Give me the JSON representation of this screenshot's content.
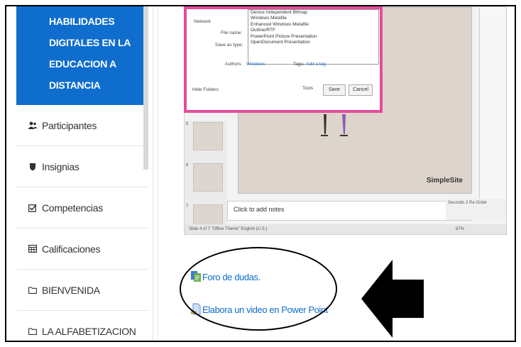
{
  "sidebar": {
    "course_title": [
      "HABILIDADES",
      "DIGITALES EN LA",
      "EDUCACION A",
      "DISTANCIA"
    ],
    "items": [
      {
        "label": "Participantes",
        "icon": "users-icon"
      },
      {
        "label": "Insignias",
        "icon": "shield-icon"
      },
      {
        "label": "Competencias",
        "icon": "checkbox-icon"
      },
      {
        "label": "Calificaciones",
        "icon": "table-icon"
      },
      {
        "label": "BIENVENIDA",
        "icon": "folder-icon"
      },
      {
        "label": "LA ALFABETIZACION",
        "icon": "folder-icon"
      }
    ]
  },
  "ppt": {
    "slide_logo": "SimpleSite",
    "notes_placeholder": "Click to add notes",
    "status_left": "Slide 4 of 7  \"Office Theme\"   English (U.S.)",
    "status_right": "67%",
    "thumb_numbers": [
      "5",
      "6",
      "7"
    ],
    "right_pane_label": "Seconds",
    "right_pane_value": "2",
    "right_pane_reorder": "Re-Order"
  },
  "dialog": {
    "type_options": [
      "Device Independent Bitmap",
      "Windows Metafile",
      "Enhanced Windows Metafile",
      "Outline/RTF",
      "PowerPoint Picture Presentation",
      "OpenDocument Presentation"
    ],
    "network_label": "Network",
    "file_name_label": "File name:",
    "save_as_type_label": "Save as type:",
    "authors_label": "Authors:",
    "authors_value": "Windows",
    "tags_label": "Tags:",
    "tags_value": "Add a tag",
    "hide_folders": "Hide Folders",
    "tools_label": "Tools",
    "save_label": "Save",
    "cancel_label": "Cancel"
  },
  "resources": [
    {
      "label": "Foro de dudas.",
      "icon": "forum-icon"
    },
    {
      "label": "Elabora un video en Power Point",
      "icon": "assignment-icon"
    }
  ],
  "colors": {
    "brand": "#0f6ecd",
    "dialog_border": "#e54b9c"
  }
}
